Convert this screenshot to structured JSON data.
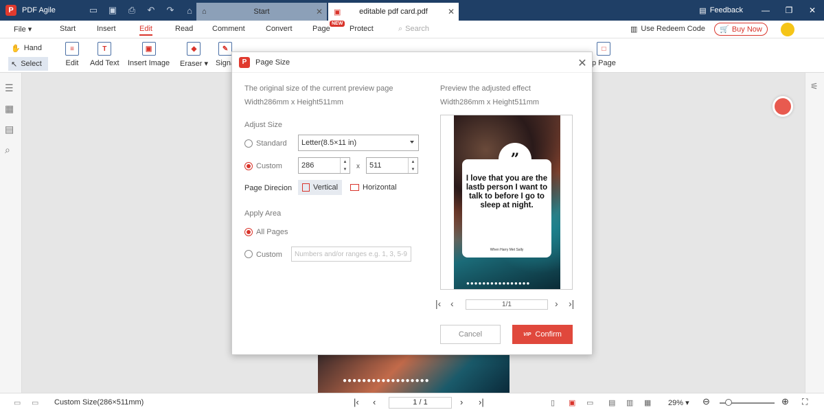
{
  "titlebar": {
    "app_name": "PDF Agile",
    "tabs": [
      {
        "label": "Start"
      },
      {
        "label": "editable pdf card.pdf"
      }
    ],
    "feedback": "Feedback"
  },
  "menubar": {
    "items": [
      "File",
      "Start",
      "Insert",
      "Edit",
      "Read",
      "Comment",
      "Convert",
      "Page",
      "Protect"
    ],
    "active": "Edit",
    "new_badge": "NEW",
    "search_placeholder": "Search",
    "redeem": "Use Redeem Code",
    "buy_now": "Buy Now"
  },
  "toolbar": {
    "hand": "Hand",
    "select": "Select",
    "tools": [
      "Edit",
      "Add Text",
      "Insert Image",
      "Eraser",
      "Signa",
      "p Page"
    ]
  },
  "dialog": {
    "title": "Page Size",
    "original_label": "The original size of the current preview page",
    "original_value": "Width286mm x Height511mm",
    "preview_label": "Preview the adjusted effect",
    "preview_value": "Width286mm x Height511mm",
    "adjust_size": "Adjust Size",
    "standard": "Standard",
    "standard_value": "Letter(8.5×11 in)",
    "custom": "Custom",
    "width": "286",
    "height": "511",
    "x": "x",
    "page_direction": "Page Direcion",
    "vertical": "Vertical",
    "horizontal": "Horizontal",
    "apply_area": "Apply Area",
    "all_pages": "All Pages",
    "custom_area": "Custom",
    "range_placeholder": "Numbers and/or ranges e.g. 1, 3, 5-9",
    "quote": "I love that you are the lastb person I want to talk to before I go to sleep at night.",
    "author": "When Harry Met Sally",
    "pager": "1/1",
    "cancel": "Cancel",
    "confirm": "Confirm",
    "vip": "VIP"
  },
  "statusbar": {
    "page_size": "Custom Size(286×511mm)",
    "page": "1 / 1",
    "zoom": "29%"
  }
}
